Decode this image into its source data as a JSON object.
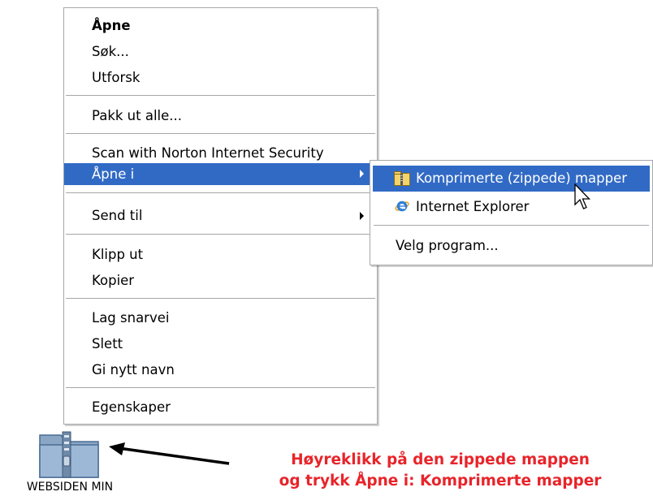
{
  "context_menu": {
    "items": [
      {
        "label": "Åpne"
      },
      {
        "label": "Søk..."
      },
      {
        "label": "Utforsk"
      },
      {
        "label": "Pakk ut alle..."
      },
      {
        "label": "Scan with Norton Internet Security"
      },
      {
        "label": "Åpne i"
      },
      {
        "label": "Send til"
      },
      {
        "label": "Klipp ut"
      },
      {
        "label": "Kopier"
      },
      {
        "label": "Lag snarvei"
      },
      {
        "label": "Slett"
      },
      {
        "label": "Gi nytt navn"
      },
      {
        "label": "Egenskaper"
      }
    ]
  },
  "submenu": {
    "items": [
      {
        "label": "Komprimerte (zippede) mapper",
        "icon": "zip-folder-icon"
      },
      {
        "label": "Internet Explorer",
        "icon": "internet-explorer-icon"
      },
      {
        "label": "Velg program..."
      }
    ]
  },
  "desktop_icon": {
    "label": "WEBSIDEN MIN",
    "icon": "zip-folder-icon"
  },
  "annotation": {
    "line1": "Høyreklikk på den zippede mappen",
    "line2": "og trykk Åpne i: Komprimerte mapper"
  },
  "colors": {
    "highlight": "#316ac5",
    "annotation": "#e8242a",
    "menu_border": "#a7a6aa"
  }
}
